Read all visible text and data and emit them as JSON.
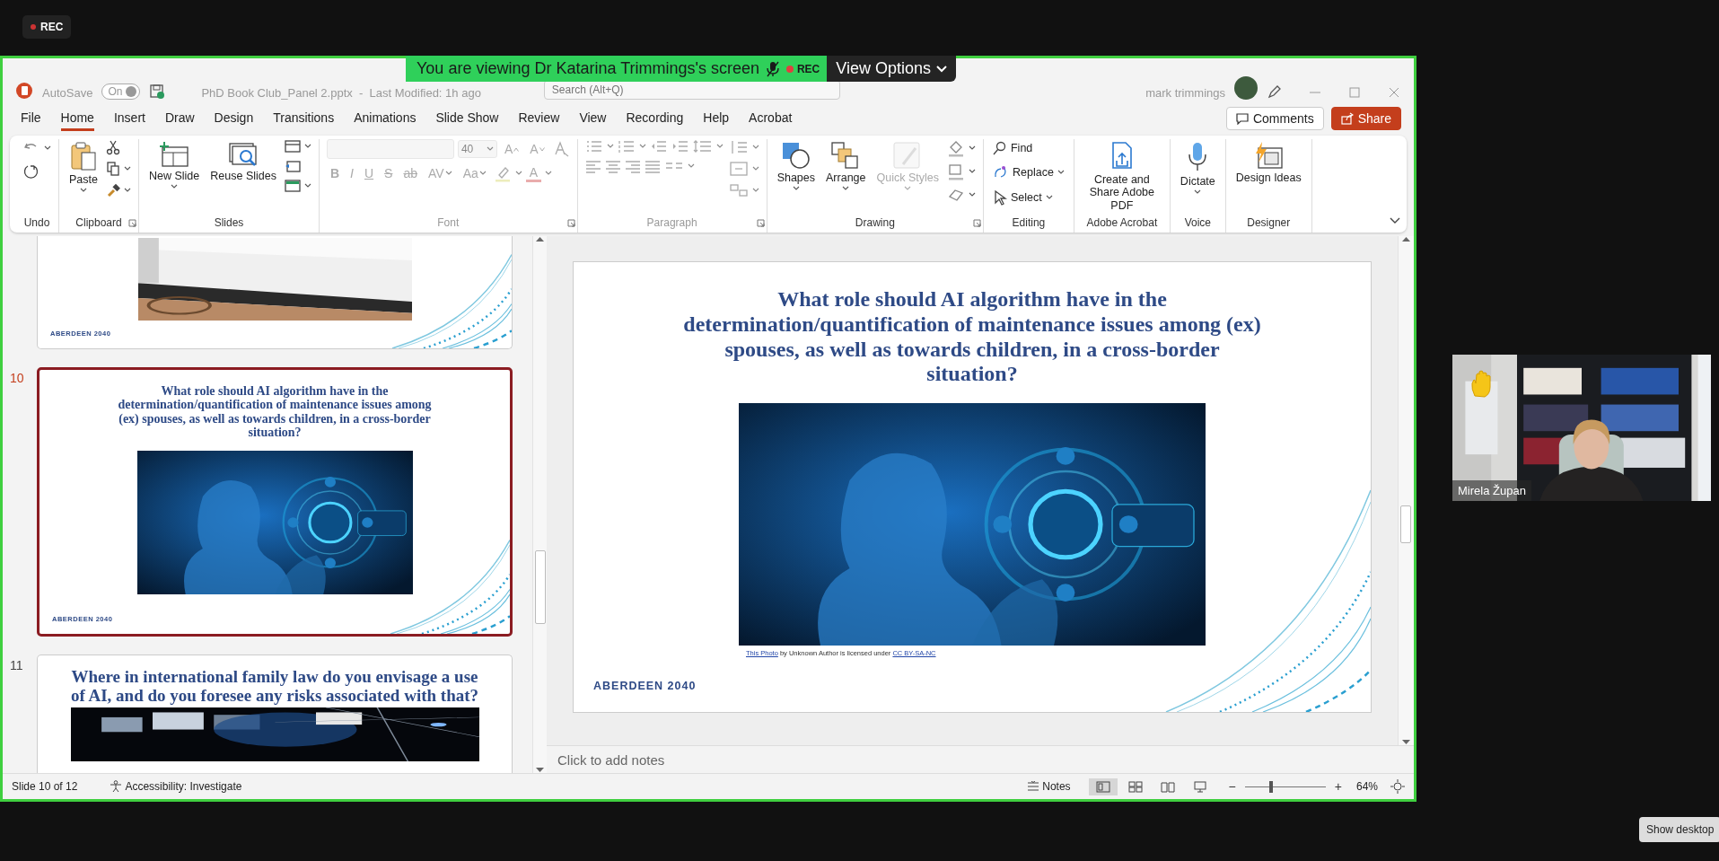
{
  "recording_badge": {
    "label": "REC"
  },
  "share_banner": {
    "text": "You are viewing Dr Katarina Trimmings's screen",
    "recording_label": "REC",
    "view_options": "View Options"
  },
  "titlebar": {
    "autosave_label": "AutoSave",
    "autosave_toggle": "On",
    "file_title": "PhD Book Club_Panel 2.pptx  -  Last Modified: 1h ago",
    "search_placeholder": "Search (Alt+Q)",
    "user_name": "mark trimmings"
  },
  "tabs": [
    {
      "label": "File",
      "selected": false
    },
    {
      "label": "Home",
      "selected": true
    },
    {
      "label": "Insert",
      "selected": false
    },
    {
      "label": "Draw",
      "selected": false
    },
    {
      "label": "Design",
      "selected": false
    },
    {
      "label": "Transitions",
      "selected": false
    },
    {
      "label": "Animations",
      "selected": false
    },
    {
      "label": "Slide Show",
      "selected": false
    },
    {
      "label": "Review",
      "selected": false
    },
    {
      "label": "View",
      "selected": false
    },
    {
      "label": "Recording",
      "selected": false
    },
    {
      "label": "Help",
      "selected": false
    },
    {
      "label": "Acrobat",
      "selected": false
    }
  ],
  "actions": [
    {
      "label": "Comments",
      "kind": "comments"
    },
    {
      "label": "Share",
      "kind": "share"
    }
  ],
  "ribbon": [
    {
      "label": "Undo",
      "kind": "undo",
      "disabled": false,
      "launcher": false
    },
    {
      "label": "Clipboard",
      "kind": "commands",
      "disabled": false,
      "launcher": true,
      "commands": [
        {
          "label": "Paste",
          "kind": "large",
          "dropdown": true,
          "disabled": false
        }
      ]
    },
    {
      "label": "Slides",
      "kind": "commands",
      "disabled": false,
      "launcher": false,
      "commands": [
        {
          "label": "New Slide",
          "kind": "large",
          "dropdown": true,
          "disabled": false
        },
        {
          "label": "Reuse Slides",
          "kind": "large",
          "dropdown": false,
          "disabled": false
        }
      ]
    },
    {
      "label": "Font",
      "kind": "font",
      "disabled": true,
      "launcher": true,
      "font_size": "40",
      "size_buttons": [
        "A",
        "A"
      ],
      "style_buttons": [
        "B",
        "I",
        "U",
        "S",
        "ab",
        "AV",
        "Aa"
      ],
      "font_color_label": "A"
    },
    {
      "label": "Paragraph",
      "kind": "paragraph",
      "disabled": true,
      "launcher": true
    },
    {
      "label": "Drawing",
      "kind": "commands",
      "disabled": false,
      "launcher": true,
      "commands": [
        {
          "label": "Shapes",
          "kind": "large",
          "dropdown": true,
          "disabled": false
        },
        {
          "label": "Arrange",
          "kind": "large",
          "dropdown": true,
          "disabled": false
        },
        {
          "label": "Quick Styles",
          "kind": "large",
          "dropdown": true,
          "disabled": true
        }
      ]
    },
    {
      "label": "Editing",
      "kind": "commands",
      "disabled": false,
      "launcher": false,
      "commands": [
        {
          "label": "Find",
          "kind": "small",
          "dropdown": false,
          "disabled": false
        },
        {
          "label": "Replace",
          "kind": "small",
          "dropdown": true,
          "disabled": false
        },
        {
          "label": "Select",
          "kind": "small",
          "dropdown": true,
          "disabled": false
        }
      ]
    },
    {
      "label": "Adobe Acrobat",
      "kind": "commands",
      "disabled": false,
      "launcher": false,
      "commands": [
        {
          "label": "Create and Share Adobe PDF",
          "kind": "large",
          "dropdown": false,
          "disabled": false
        }
      ]
    },
    {
      "label": "Voice",
      "kind": "commands",
      "disabled": false,
      "launcher": false,
      "commands": [
        {
          "label": "Dictate",
          "kind": "large",
          "dropdown": true,
          "disabled": false
        }
      ]
    },
    {
      "label": "Designer",
      "kind": "commands",
      "disabled": false,
      "launcher": false,
      "commands": [
        {
          "label": "Design Ideas",
          "kind": "large",
          "dropdown": false,
          "disabled": false
        }
      ]
    }
  ],
  "thumbnails": [
    {
      "kind": "cut-top",
      "selected": false,
      "footer": "ABERDEEN 2040"
    },
    {
      "kind": "full",
      "number": "10",
      "selected": true,
      "title": "What role should AI algorithm have in the determination/quantification of maintenance issues among (ex) spouses, as well as towards children, in a cross-border situation?",
      "footer": "ABERDEEN 2040"
    },
    {
      "kind": "cut-bottom",
      "number": "11",
      "selected": false,
      "title": "Where in international family law do you envisage a use of AI, and do you foresee any risks associated with that?"
    }
  ],
  "slide": {
    "title": "What role should AI algorithm have in the determination/quantification of maintenance issues among (ex) spouses, as well as towards children, in a cross-border situation?",
    "caption": {
      "link": "This Photo",
      "text": "by Unknown Author is licensed under",
      "license": "CC BY-SA-NC"
    },
    "footer": "ABERDEEN 2040"
  },
  "notes": {
    "placeholder": "Click to add notes"
  },
  "status_bar": {
    "slide_position": "Slide 10 of 12",
    "accessibility": "Accessibility: Investigate",
    "notes_label": "Notes",
    "views": [
      {
        "selected": true
      },
      {
        "selected": false
      },
      {
        "selected": false
      },
      {
        "selected": false
      }
    ],
    "zoom_out": "−",
    "zoom_in": "+",
    "zoom": {
      "level": 0.33,
      "reading": "64%"
    }
  },
  "video": {
    "participant": "Mirela Župan",
    "hand_raised": true
  },
  "show_desktop": "Show desktop"
}
